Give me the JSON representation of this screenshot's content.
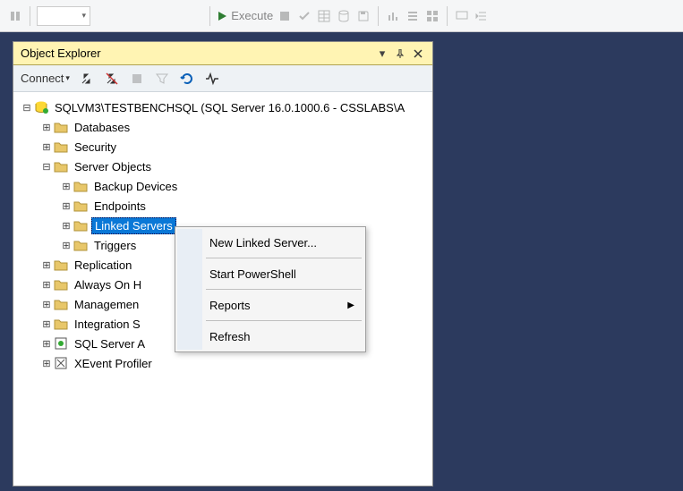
{
  "toolbar": {
    "execute_label": "Execute"
  },
  "explorer": {
    "title": "Object Explorer",
    "connect_label": "Connect",
    "server_label": "SQLVM3\\TESTBENCHSQL (SQL Server 16.0.1000.6 - CSSLABS\\A",
    "nodes": {
      "databases": "Databases",
      "security": "Security",
      "server_objects": "Server Objects",
      "backup_devices": "Backup Devices",
      "endpoints": "Endpoints",
      "linked_servers": "Linked Servers",
      "triggers": "Triggers",
      "replication": "Replication",
      "always_on": "Always On H",
      "management": "Managemen",
      "integration": "Integration S",
      "sql_agent": "SQL Server A",
      "xevent": "XEvent Profiler"
    }
  },
  "context_menu": {
    "new_linked_server": "New Linked Server...",
    "start_powershell": "Start PowerShell",
    "reports": "Reports",
    "refresh": "Refresh"
  }
}
